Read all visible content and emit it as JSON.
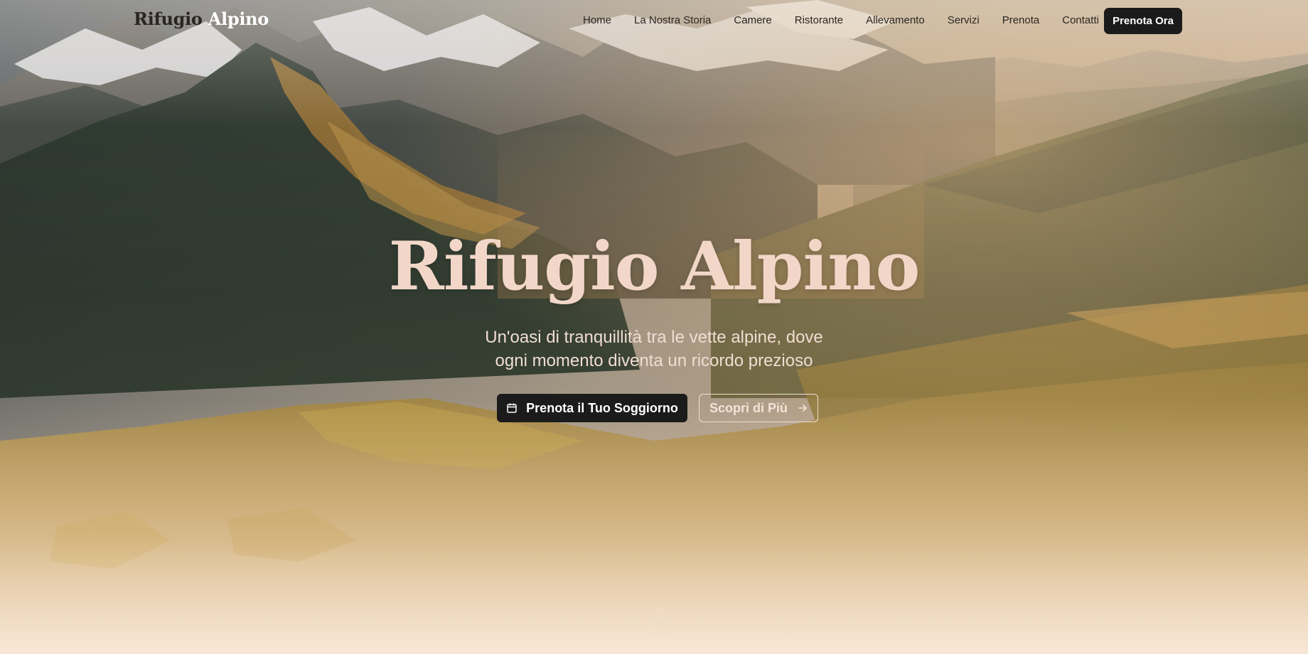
{
  "nav": {
    "logo_word1": "Rifugio",
    "logo_word2": "Alpino",
    "links": [
      "Home",
      "La Nostra Storia",
      "Camere",
      "Ristorante",
      "Allevamento",
      "Servizi",
      "Prenota",
      "Contatti"
    ],
    "cta_label": "Prenota Ora"
  },
  "hero": {
    "title": "Rifugio Alpino",
    "subtitle_line1": "Un'oasi di tranquillità tra le vette alpine, dove",
    "subtitle_line2": "ogni momento diventa un ricordo prezioso",
    "primary_button_label": "Prenota il Tuo Soggiorno",
    "primary_button_icon": "calendar-icon",
    "secondary_button_label": "Scopri di Più",
    "secondary_button_icon": "arrow-right-icon"
  },
  "colors": {
    "title": "#f2d7c9",
    "button_dark": "#1b1b1b",
    "warm_glow": "#f3c998"
  }
}
